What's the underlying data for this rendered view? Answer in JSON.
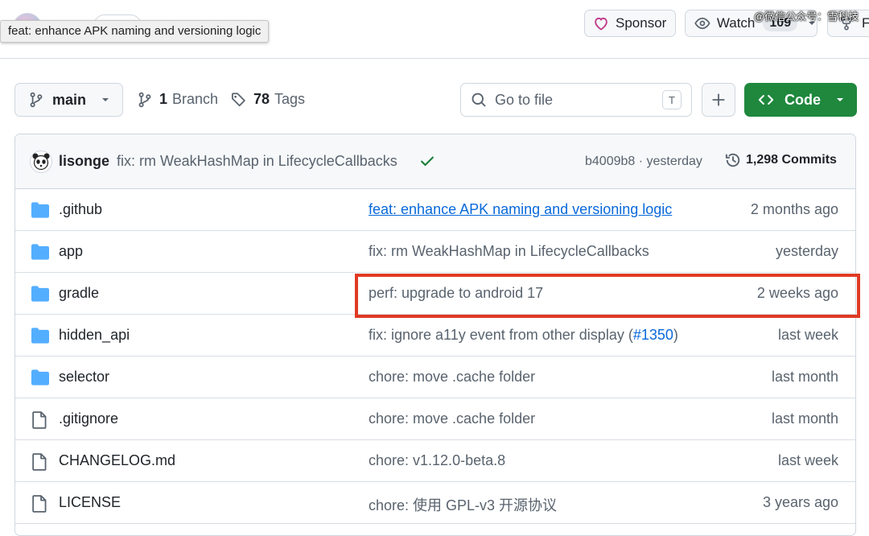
{
  "tooltip": "feat: enhance APK naming and versioning logic",
  "header": {
    "sponsor_label": "Sponsor",
    "watch_label": "Watch",
    "watch_count": "109",
    "fork_label": "F",
    "watermark": "@微信公众号：雪科技"
  },
  "nav": {
    "branch": "main",
    "branches_count": "1",
    "branches_label": "Branch",
    "tags_count": "78",
    "tags_label": "Tags",
    "goto_placeholder": "Go to file",
    "goto_shortcut": "T",
    "code_label": "Code"
  },
  "latest_commit": {
    "author": "lisonge",
    "message": "fix: rm WeakHashMap in LifecycleCallbacks",
    "sha_age": "b4009b8 · yesterday",
    "commits_label": "1,298 Commits"
  },
  "files": [
    {
      "name": ".github",
      "type": "folder",
      "message": "feat: enhance APK naming and versioning logic",
      "age": "2 months ago"
    },
    {
      "name": "app",
      "type": "folder",
      "message": "fix: rm WeakHashMap in LifecycleCallbacks",
      "age": "yesterday"
    },
    {
      "name": "gradle",
      "type": "folder",
      "message": "perf: upgrade to android 17",
      "age": "2 weeks ago"
    },
    {
      "name": "hidden_api",
      "type": "folder",
      "message_prefix": "fix: ignore a11y event from other display (",
      "message_link": "#1350",
      "message_suffix": ")",
      "age": "last week"
    },
    {
      "name": "selector",
      "type": "folder",
      "message": "chore: move .cache folder",
      "age": "last month"
    },
    {
      "name": ".gitignore",
      "type": "file",
      "message": "chore: move .cache folder",
      "age": "last month"
    },
    {
      "name": "CHANGELOG.md",
      "type": "file",
      "message": "chore: v1.12.0-beta.8",
      "age": "last week"
    },
    {
      "name": "LICENSE",
      "type": "file",
      "message": "chore: 使用 GPL-v3 开源协议",
      "age": "3 years ago"
    }
  ],
  "colors": {
    "folder_icon": "#54aeff",
    "code_button": "#1f883d",
    "highlight_box": "#e03a24",
    "link": "#0969da"
  }
}
